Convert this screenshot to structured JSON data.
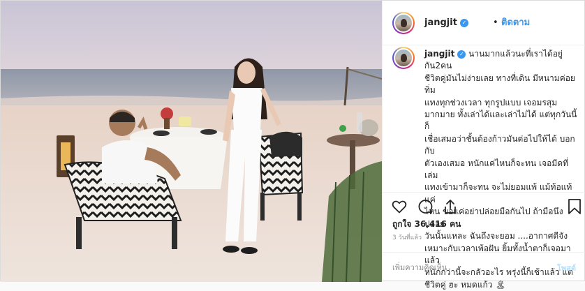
{
  "header": {
    "username": "jangjit",
    "separator": "•",
    "follow_label": "ติดตาม"
  },
  "caption": {
    "username": "jangjit",
    "text": "นานมากแล้วนะที่เราได้อยู่กัน2คน\nชีวิตคู่มันไม่ง่ายเลย ทางที่เดิน มีหนามค่อยทิ่ม\nแทงทุกช่วงเวลา ทุกรูปแบบ เจอมรสุม\nมากมาย ทั้งเล่าได้และเล่าไม่ได้ แต่ทุกวันนี้ก็\nเชื่อเสมอว่าชั้นต้องก้าวมันต่อไปให้ได้ บอกกับ\nตัวเองเสมอ หนักแค่ไหนก็จะทน เจอมีดที่เล่ม\nแทงเข้ามาก็จะทน จะไม่ยอมแพ้ แม้ท้อแท้แค่\nไหน ขอแค่อย่าปล่อยมือกันไป ถ้ามือนึงปล่อย\nวันนั้นแหละ ฉันถึงจะยอม ....อากาศดีจัง\nเหมาะกับเวลาเพ้อฝัน ยิ้มทั้งน้ำตาก็เจอมาแล้ว\nหนักกว่านี้จะกลัวอะไร พรุ่งนี้ก็เช้าแล้ว แต่\nชีวิตคู่ ฮะ หมดแก้ว",
    "emoji": "🏝"
  },
  "icons": {
    "heart": "heart-icon",
    "comment": "comment-icon",
    "share": "share-icon",
    "save": "bookmark-icon",
    "verified": "verified-badge-icon"
  },
  "stats": {
    "likes_label": "ถูกใจ 36,416 คน",
    "time_label": "3 วันที่แล้ว"
  },
  "comment_box": {
    "placeholder": "เพิ่มความคิดเห็น",
    "post_label": "โพสต์"
  },
  "colors": {
    "accent": "#3897f0",
    "post_disabled": "#b2dffc",
    "muted": "#8e8e8e"
  }
}
